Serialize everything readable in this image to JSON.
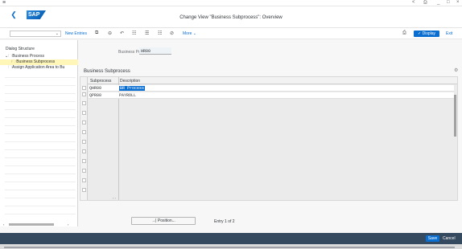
{
  "system": {
    "menu_icon": "hamburger-icon",
    "window_controls": [
      "<",
      "⎙",
      "_",
      "□",
      "×"
    ]
  },
  "header": {
    "back_icon": "chevron-left-icon",
    "logo": "SAP",
    "title": "Change View \"Business Subprocess\": Overview"
  },
  "toolbar": {
    "new_entries": "New Entries",
    "more": "More",
    "display": "Display",
    "exit": "Exit",
    "icons": [
      "copy-icon",
      "delete-icon",
      "undo-icon",
      "select-all-icon",
      "select-block-icon",
      "deselect-icon",
      "other-view-icon"
    ]
  },
  "tree": {
    "label": "Dialog Structure",
    "items": [
      {
        "label": "Business Process"
      },
      {
        "label": "Business Subprocess"
      },
      {
        "label": "Assign Application Area to Bu"
      }
    ]
  },
  "main": {
    "bp_label": "Business Process:",
    "bp_value": "HR00",
    "section_title": "Business Subprocess",
    "columns": [
      "Subprocess",
      "Description"
    ],
    "rows": [
      {
        "code": "QHR00",
        "desc": "BR Process"
      },
      {
        "code": "QPR00",
        "desc": "PAYROLL"
      }
    ],
    "position_button": "Position...",
    "entry_text": "Entry 1 of 2"
  },
  "footer": {
    "save": "Save",
    "cancel": "Cancel"
  },
  "colors": {
    "accent": "#0a6ed1",
    "footer_bg": "#354a5f",
    "selected_node": "#fff6b8"
  }
}
